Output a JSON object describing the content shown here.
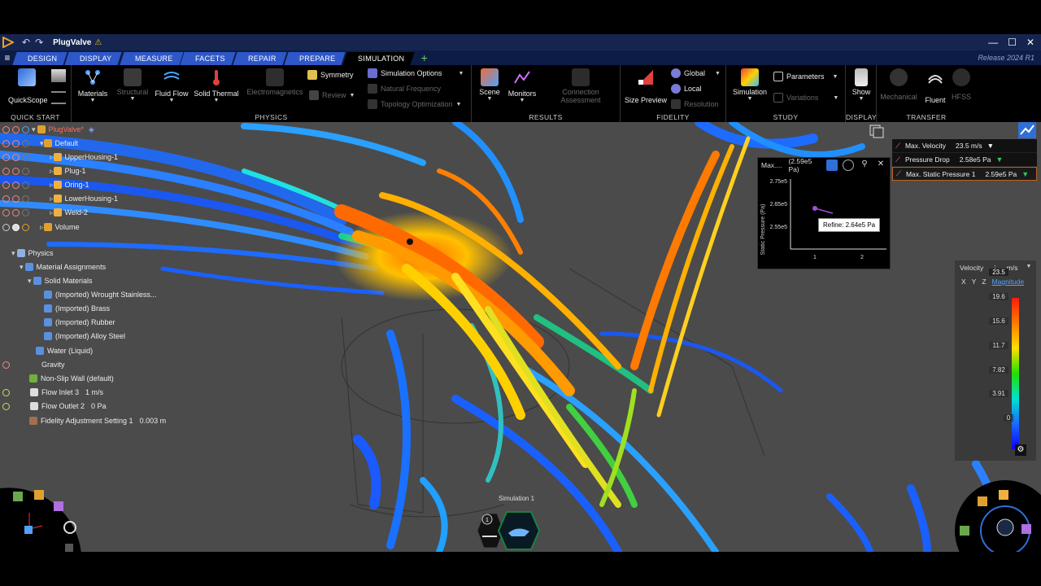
{
  "titlebar": {
    "doc_title": "PlugValve",
    "min": "—",
    "max": "☐",
    "close": "✕"
  },
  "tabs": [
    {
      "label": "DESIGN",
      "active": false
    },
    {
      "label": "DISPLAY",
      "active": false
    },
    {
      "label": "MEASURE",
      "active": false
    },
    {
      "label": "FACETS",
      "active": false
    },
    {
      "label": "REPAIR",
      "active": false
    },
    {
      "label": "PREPARE",
      "active": false
    },
    {
      "label": "SIMULATION",
      "active": true
    }
  ],
  "release": "Release 2024 R1",
  "ribbon": {
    "quickscope": "QuickScope",
    "quickstart_label": "QUICK START",
    "materials": "Materials",
    "structural": "Structural",
    "fluid_flow": "Fluid Flow",
    "solid_thermal": "Solid Thermal",
    "electromagnetics": "Electromagnetics",
    "symmetry": "Symmetry",
    "review": "Review",
    "simulation_options": "Simulation Options",
    "natural_frequency": "Natural Frequency",
    "topology_optimization": "Topology Optimization",
    "physics_label": "PHYSICS",
    "scene": "Scene",
    "monitors": "Monitors",
    "connection_assessment": "Connection Assessment",
    "results_label": "RESULTS",
    "size_preview": "Size Preview",
    "global": "Global",
    "local": "Local",
    "resolution": "Resolution",
    "fidelity_label": "FIDELITY",
    "simulation": "Simulation",
    "parameters": "Parameters",
    "variations": "Variations",
    "study_label": "STUDY",
    "show": "Show",
    "display_label": "DISPLAY",
    "mechanical": "Mechanical",
    "fluent": "Fluent",
    "hfss": "HFSS",
    "transfer_label": "TRANSFER"
  },
  "tree": {
    "root": "PlugValve*",
    "default": "Default",
    "parts": [
      "UpperHousing-1",
      "Plug-1",
      "Oring-1",
      "LowerHousing-1",
      "Weld-2"
    ],
    "volume": "Volume",
    "physics": "Physics",
    "material_assignments": "Material Assignments",
    "solid_materials": "Solid Materials",
    "materials": [
      "(Imported) Wrought Stainless...",
      "(Imported) Brass",
      "(Imported) Rubber",
      "(Imported) Alloy Steel"
    ],
    "water": "Water (Liquid)",
    "gravity": "Gravity",
    "wall": "Non-Slip Wall (default)",
    "inlet": "Flow Inlet 3",
    "inlet_val": "1 m/s",
    "outlet": "Flow Outlet 2",
    "outlet_val": "0 Pa",
    "fidelity": "Fidelity Adjustment Setting 1",
    "fidelity_val": "0.003 m"
  },
  "monitor": {
    "title": "Max....",
    "value": "(2.59e5 Pa)",
    "ylabel": "Static Pressure (Pa)",
    "yticks": [
      "2.75e5",
      "2.65e5",
      "2.55e5"
    ],
    "xticks": [
      "1",
      "2"
    ],
    "tooltip": "Refine: 2.64e5 Pa"
  },
  "results": [
    {
      "name": "Max. Velocity",
      "value": "23.5 m/s",
      "marker": "▼",
      "selected": false
    },
    {
      "name": "Pressure Drop",
      "value": "2.58e5 Pa",
      "marker": "▼",
      "selected": false
    },
    {
      "name": "Max. Static Pressure 1",
      "value": "2.59e5 Pa",
      "marker": "▼",
      "selected": true
    }
  ],
  "legend": {
    "quantity": "Velocity",
    "unit": "m/s",
    "x": "X",
    "y": "Y",
    "z": "Z",
    "magnitude": "Magnitude",
    "ticks": [
      "23.5",
      "19.6",
      "15.6",
      "11.7",
      "7.82",
      "3.91",
      "0"
    ]
  },
  "bottom": {
    "sim_label": "Simulation 1",
    "badge": "1"
  },
  "colors": {
    "accent": "#2e57c9",
    "titlebar": "#15254f",
    "viewport_bg": "#4b4b4b"
  }
}
